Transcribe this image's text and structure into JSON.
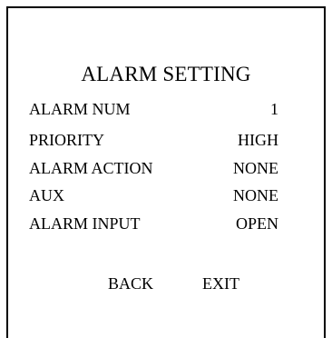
{
  "menu": {
    "title": "ALARM SETTING",
    "rows": [
      {
        "label": "ALARM NUM",
        "value": "1"
      },
      {
        "label": "PRIORITY",
        "value": "HIGH"
      },
      {
        "label": "ALARM ACTION",
        "value": "NONE"
      },
      {
        "label": "AUX",
        "value": "NONE"
      },
      {
        "label": "ALARM INPUT",
        "value": "OPEN"
      }
    ],
    "buttons": {
      "back": "BACK",
      "exit": "EXIT"
    }
  },
  "colors": {
    "background": "#ffffff",
    "text": "#000000",
    "border": "#000000"
  }
}
